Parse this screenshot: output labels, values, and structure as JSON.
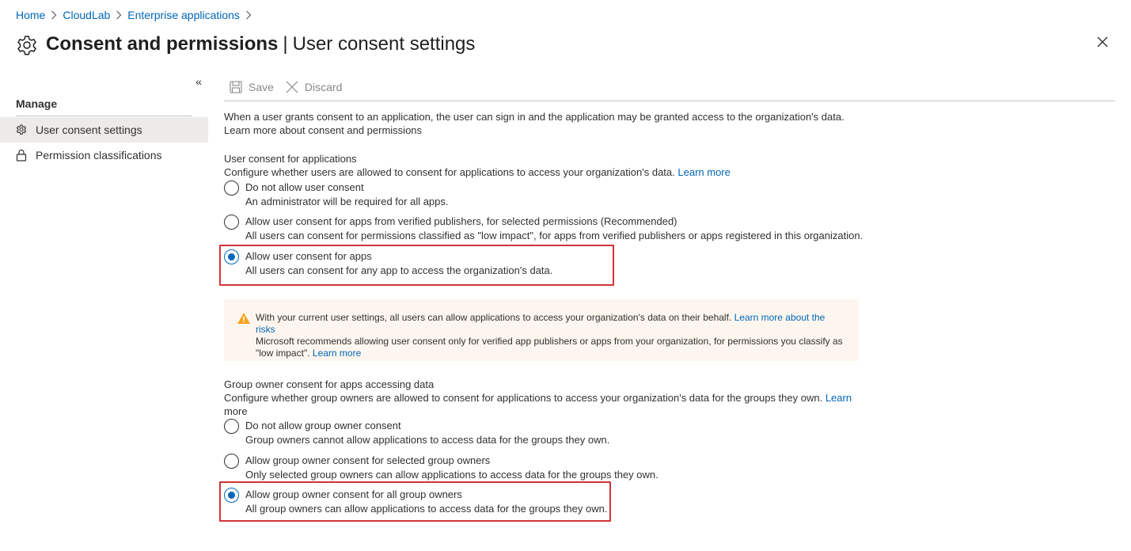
{
  "breadcrumb": {
    "items": [
      "Home",
      "CloudLab",
      "Enterprise applications"
    ]
  },
  "header": {
    "title": "Consent and permissions",
    "divider": "|",
    "subtitle": "User consent settings",
    "title_icon": "gear-icon",
    "close_icon": "close-icon"
  },
  "sidebar": {
    "collapse_label": "«",
    "heading": "Manage",
    "items": [
      {
        "label": "User consent settings",
        "icon": "gear-icon",
        "active": true
      },
      {
        "label": "Permission classifications",
        "icon": "lock-icon",
        "active": false
      }
    ]
  },
  "toolbar": {
    "save_label": "Save",
    "discard_label": "Discard"
  },
  "intro": {
    "text": "When a user grants consent to an application, the user can sign in and the application may be granted access to the organization's data.",
    "link": "Learn more about consent and permissions"
  },
  "user_consent": {
    "heading": "User consent for applications",
    "description": "Configure whether users are allowed to consent for applications to access your organization's data.",
    "learn_more": "Learn more",
    "options": [
      {
        "label": "Do not allow user consent",
        "description": "An administrator will be required for all apps.",
        "selected": false
      },
      {
        "label": "Allow user consent for apps from verified publishers, for selected permissions (Recommended)",
        "description": "All users can consent for permissions classified as \"low impact\", for apps from verified publishers or apps registered in this organization.",
        "selected": false
      },
      {
        "label": "Allow user consent for apps",
        "description": "All users can consent for any app to access the organization's data.",
        "selected": true
      }
    ]
  },
  "warning": {
    "icon": "warning-icon",
    "line1": "With your current user settings, all users can allow applications to access your organization's data on their behalf.",
    "line1_link": "Learn more about the risks",
    "line2": "Microsoft recommends allowing user consent only for verified app publishers or apps from your organization, for permissions you classify as",
    "line3": "\"low impact\".",
    "line3_link": "Learn more"
  },
  "group_consent": {
    "heading": "Group owner consent for apps accessing data",
    "description": "Configure whether group owners are allowed to consent for applications to access your organization's data for the groups they own.",
    "learn_more_part1": "Learn",
    "learn_more_part2": "more",
    "options": [
      {
        "label": "Do not allow group owner consent",
        "description": "Group owners cannot allow applications to access data for the groups they own.",
        "selected": false
      },
      {
        "label": "Allow group owner consent for selected group owners",
        "description": "Only selected group owners can allow applications to access data for the groups they own.",
        "selected": false
      },
      {
        "label": "Allow group owner consent for all group owners",
        "description": "All group owners can allow applications to access data for the groups they own.",
        "selected": true
      }
    ]
  },
  "colors": {
    "link": "#0067b8",
    "highlight": "#d13438",
    "warning_bg": "#fdf6ee",
    "warning_icon": "#f7a21c"
  }
}
